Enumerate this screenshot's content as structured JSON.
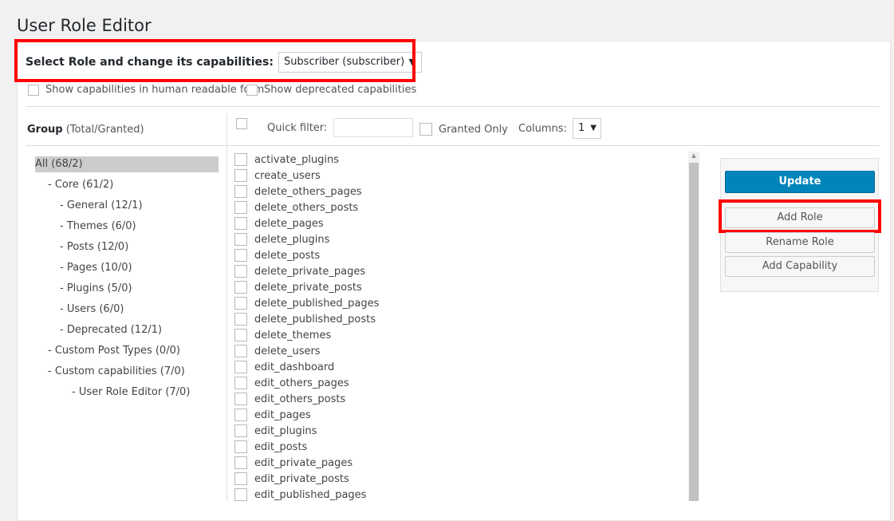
{
  "page": {
    "title": "User Role Editor"
  },
  "role_selector": {
    "label": "Select Role and change its capabilities:",
    "selected": "Subscriber (subscriber)"
  },
  "options": {
    "human_readable": "Show capabilities in human readable form",
    "deprecated": "Show deprecated capabilities"
  },
  "group_header": {
    "title": "Group",
    "subtitle": "(Total/Granted)"
  },
  "filter": {
    "quick_filter_label": "Quick filter:",
    "quick_filter_value": "",
    "granted_only_label": "Granted Only",
    "columns_label": "Columns:",
    "columns_value": "1"
  },
  "groups": [
    {
      "label": "All (68/2)"
    },
    {
      "label": "- Core (61/2)"
    },
    {
      "label": "- General (12/1)"
    },
    {
      "label": "- Themes (6/0)"
    },
    {
      "label": "- Posts (12/0)"
    },
    {
      "label": "- Pages (10/0)"
    },
    {
      "label": "- Plugins (5/0)"
    },
    {
      "label": "- Users (6/0)"
    },
    {
      "label": "- Deprecated (12/1)"
    },
    {
      "label": "- Custom Post Types (0/0)"
    },
    {
      "label": "- Custom capabilities (7/0)"
    },
    {
      "label": "- User Role Editor (7/0)"
    }
  ],
  "capabilities": [
    "activate_plugins",
    "create_users",
    "delete_others_pages",
    "delete_others_posts",
    "delete_pages",
    "delete_plugins",
    "delete_posts",
    "delete_private_pages",
    "delete_private_posts",
    "delete_published_pages",
    "delete_published_posts",
    "delete_themes",
    "delete_users",
    "edit_dashboard",
    "edit_others_pages",
    "edit_others_posts",
    "edit_pages",
    "edit_plugins",
    "edit_posts",
    "edit_private_pages",
    "edit_private_posts",
    "edit_published_pages"
  ],
  "actions": {
    "update": "Update",
    "add_role": "Add Role",
    "rename_role": "Rename Role",
    "add_capability": "Add Capability"
  },
  "colors": {
    "primary": "#0085ba",
    "highlight": "#ff0000"
  }
}
